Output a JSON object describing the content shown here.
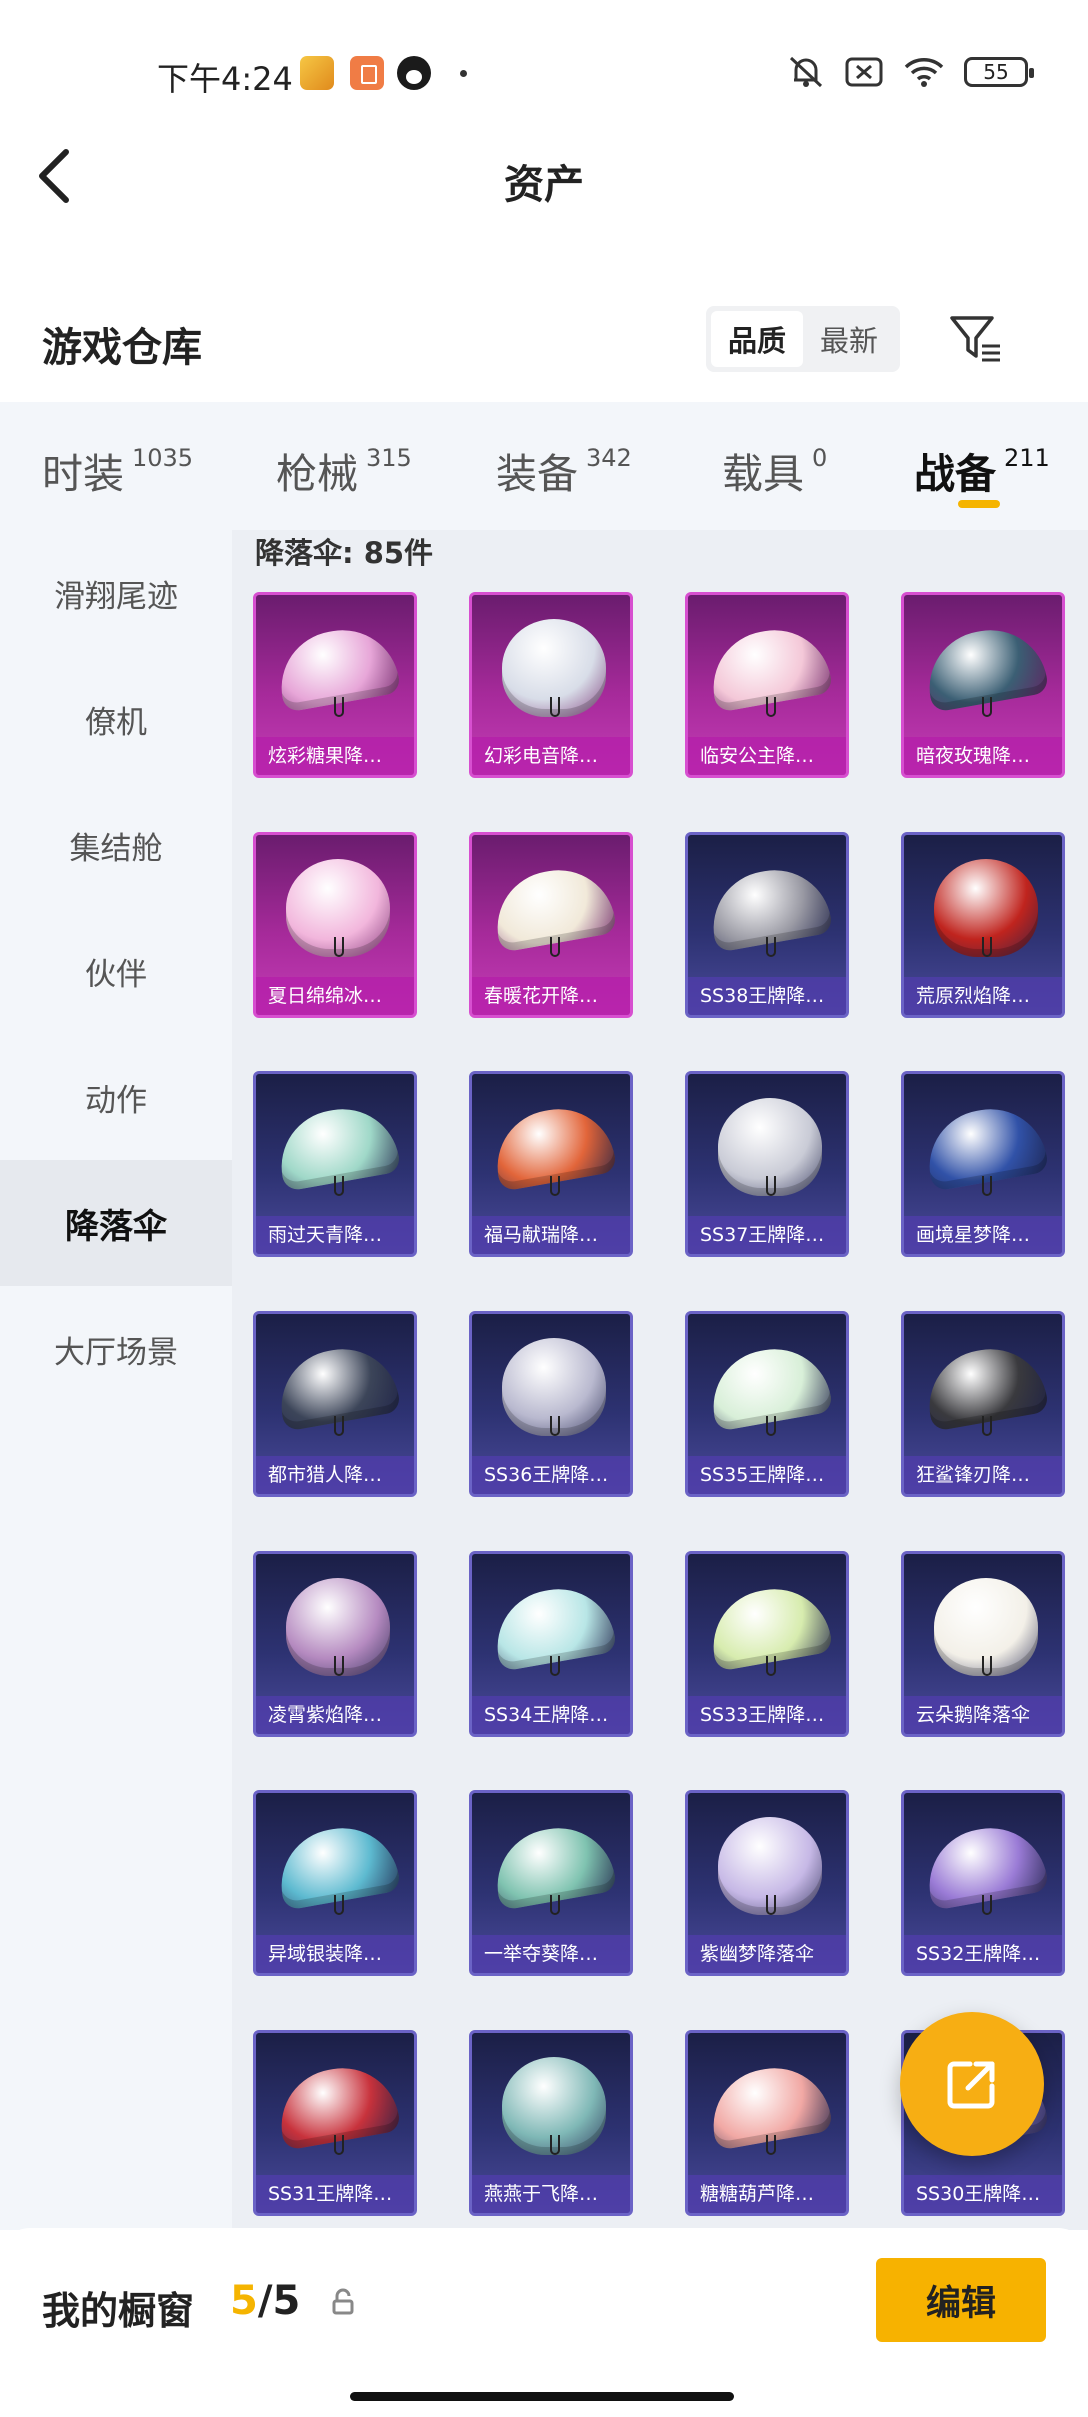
{
  "status_bar": {
    "time": "下午4:24",
    "battery": "55"
  },
  "header": {
    "title": "资产"
  },
  "warehouse": {
    "title": "游戏仓库",
    "sort_options": [
      "品质",
      "最新"
    ],
    "active_sort": "品质"
  },
  "tabs": [
    {
      "label": "时装",
      "count": "1035"
    },
    {
      "label": "枪械",
      "count": "315"
    },
    {
      "label": "装备",
      "count": "342"
    },
    {
      "label": "载具",
      "count": "0"
    },
    {
      "label": "战备",
      "count": "211"
    }
  ],
  "active_tab": "战备",
  "sidebar": {
    "items": [
      {
        "label": "滑翔尾迹"
      },
      {
        "label": "僚机"
      },
      {
        "label": "集结舱"
      },
      {
        "label": "伙伴"
      },
      {
        "label": "动作"
      },
      {
        "label": "降落伞"
      },
      {
        "label": "大厅场景"
      }
    ],
    "active": "降落伞"
  },
  "content": {
    "header": "降落伞: 85件",
    "items": [
      {
        "name": "炫彩糖果降…",
        "rarity": "pink",
        "color": "#e7a6d8"
      },
      {
        "name": "幻彩电音降…",
        "rarity": "pink",
        "color": "#d8dde8"
      },
      {
        "name": "临安公主降…",
        "rarity": "pink",
        "color": "#f4c8d8"
      },
      {
        "name": "暗夜玫瑰降…",
        "rarity": "pink",
        "color": "#3b5f74"
      },
      {
        "name": "夏日绵绵冰…",
        "rarity": "pink",
        "color": "#f2b6dc"
      },
      {
        "name": "春暖花开降…",
        "rarity": "pink",
        "color": "#f1e9d9"
      },
      {
        "name": "SS38王牌降…",
        "rarity": "blue",
        "color": "#9a9aa4"
      },
      {
        "name": "荒原烈焰降…",
        "rarity": "blue",
        "color": "#c0241e"
      },
      {
        "name": "雨过天青降…",
        "rarity": "blue",
        "color": "#9fd8c8"
      },
      {
        "name": "福马献瑞降…",
        "rarity": "blue",
        "color": "#e2653a"
      },
      {
        "name": "SS37王牌降…",
        "rarity": "blue",
        "color": "#c9cbd6"
      },
      {
        "name": "画境星梦降…",
        "rarity": "blue",
        "color": "#3152a8"
      },
      {
        "name": "都市猎人降…",
        "rarity": "blue",
        "color": "#3c4559"
      },
      {
        "name": "SS36王牌降…",
        "rarity": "blue",
        "color": "#b9b9cf"
      },
      {
        "name": "SS35王牌降…",
        "rarity": "blue",
        "color": "#d8efd8"
      },
      {
        "name": "狂鲨锋刃降…",
        "rarity": "blue",
        "color": "#3a3a3e"
      },
      {
        "name": "凌霄紫焰降…",
        "rarity": "blue",
        "color": "#b58ac0"
      },
      {
        "name": "SS34王牌降…",
        "rarity": "blue",
        "color": "#b8e6e6"
      },
      {
        "name": "SS33王牌降…",
        "rarity": "blue",
        "color": "#d7ecae"
      },
      {
        "name": "云朵鹅降落伞",
        "rarity": "blue",
        "color": "#f3f0e8"
      },
      {
        "name": "异域银装降…",
        "rarity": "blue",
        "color": "#5dbad0"
      },
      {
        "name": "一举夺葵降…",
        "rarity": "blue",
        "color": "#7fc3b0"
      },
      {
        "name": "紫幽梦降落伞",
        "rarity": "blue",
        "color": "#c6b8e6"
      },
      {
        "name": "SS32王牌降…",
        "rarity": "blue",
        "color": "#9a7bd6"
      },
      {
        "name": "SS31王牌降…",
        "rarity": "blue",
        "color": "#c8323c"
      },
      {
        "name": "燕燕于飞降…",
        "rarity": "blue",
        "color": "#7fb8b6"
      },
      {
        "name": "糖糖葫芦降…",
        "rarity": "blue",
        "color": "#f1a8a4"
      },
      {
        "name": "SS30王牌降…",
        "rarity": "blue",
        "color": "#8f7fd4"
      }
    ]
  },
  "bottom_bar": {
    "label": "我的橱窗",
    "current": "5",
    "total": "/5",
    "edit_label": "编辑"
  },
  "colors": {
    "accent": "#f5b400",
    "pink_rarity": "#d74fd0",
    "blue_rarity": "#6b63c6"
  }
}
